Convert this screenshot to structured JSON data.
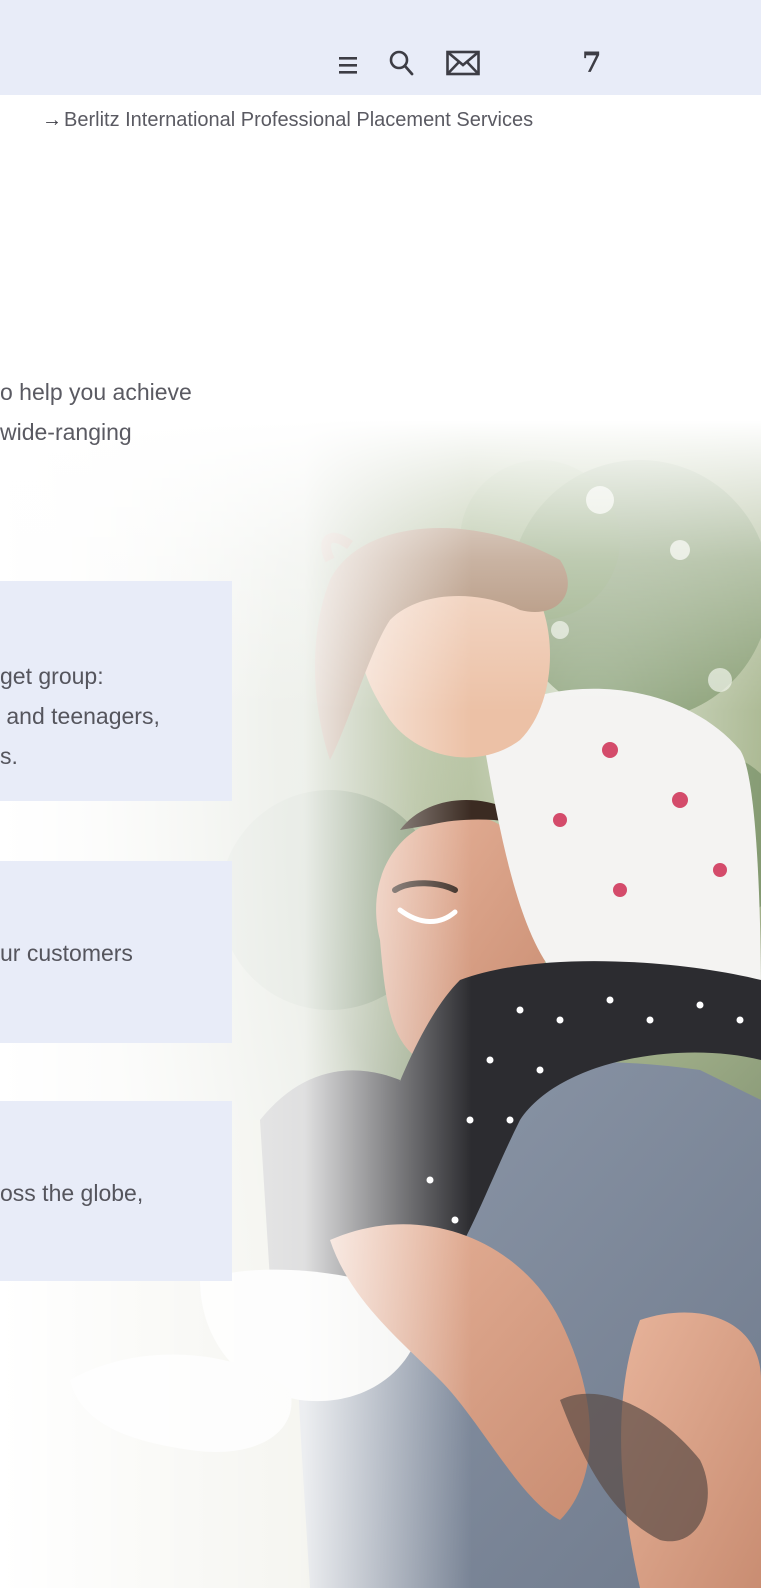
{
  "header": {
    "menu_icon": "menu-icon",
    "search_icon": "search-icon",
    "mail_icon": "mail-icon",
    "page_number": "7"
  },
  "breadcrumb": {
    "arrow": "→",
    "label": "Berlitz International Professional Placement Services"
  },
  "intro": {
    "line1": "o help you achieve",
    "line2": "wide-ranging"
  },
  "cards": [
    {
      "text": "get group:\n and teenagers,\ns."
    },
    {
      "text": "ur customers"
    },
    {
      "text": "oss the globe,"
    }
  ],
  "colors": {
    "panel": "#e8ecf8",
    "text": "#4a4a52"
  }
}
